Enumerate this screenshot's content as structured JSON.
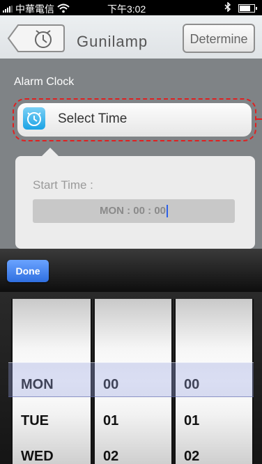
{
  "status_bar": {
    "carrier": "中華電信",
    "time": "下午3:02"
  },
  "nav": {
    "title": "Gunilamp",
    "determine_label": "Determine"
  },
  "section": {
    "title": "Alarm Clock"
  },
  "select_time": {
    "label": "Select Time"
  },
  "card": {
    "start_label": "Start Time :",
    "time_value": "MON : 00 : 00"
  },
  "toolbar": {
    "done_label": "Done"
  },
  "picker": {
    "days": [
      "MON",
      "TUE",
      "WED"
    ],
    "hours": [
      "00",
      "01",
      "02"
    ],
    "minutes": [
      "00",
      "01",
      "02"
    ]
  },
  "colors": {
    "accent_blue": "#2f6fe0",
    "highlight_red": "#e02020"
  }
}
